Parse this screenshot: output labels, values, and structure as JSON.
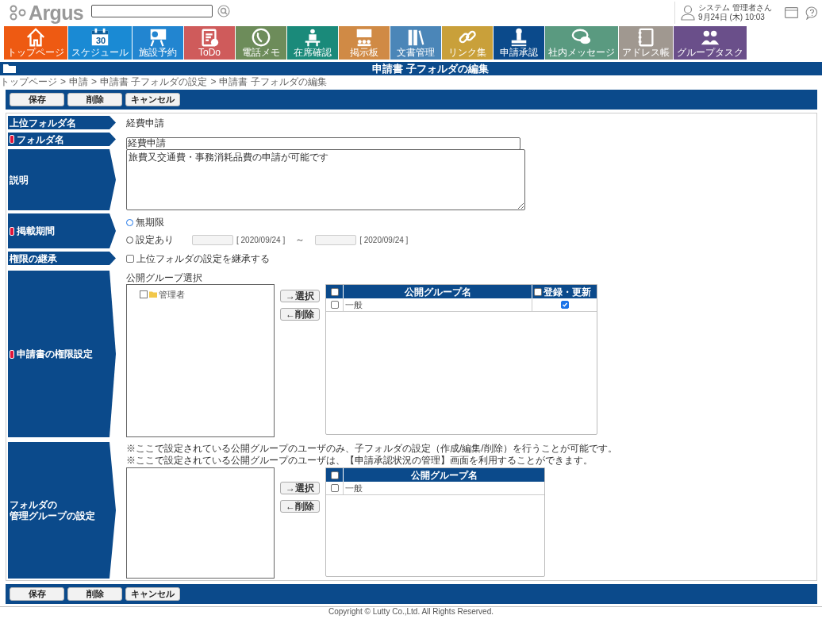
{
  "header": {
    "logo": "Argus",
    "user": {
      "name": "システム 管理者さん",
      "datetime": "9月24日 (木) 10:03"
    }
  },
  "nav": [
    {
      "label": "トップページ",
      "color": "#ee5a12"
    },
    {
      "label": "スケジュール",
      "icon_text": "30",
      "color": "#1a8ad4"
    },
    {
      "label": "施設予約",
      "color": "#2285d0"
    },
    {
      "label": "ToDo",
      "color": "#cf5b5b"
    },
    {
      "label": "電話メモ",
      "color": "#6d8c5a"
    },
    {
      "label": "在席確認",
      "color": "#1a8a7a"
    },
    {
      "label": "掲示板",
      "color": "#d08a45"
    },
    {
      "label": "文書管理",
      "color": "#4b86b8"
    },
    {
      "label": "リンク集",
      "color": "#c9a03a"
    },
    {
      "label": "申請承認",
      "color": "#0b4a8b"
    },
    {
      "label": "社内メッセージ",
      "color": "#5a9a80"
    },
    {
      "label": "アドレス帳",
      "color": "#a09890"
    },
    {
      "label": "グループタスク",
      "color": "#6a4f8a"
    }
  ],
  "title": "申請書 子フォルダの編集",
  "breadcrumb": {
    "separator": ">",
    "items": [
      "トップページ",
      "申請",
      "申請書 子フォルダの設定",
      "申請書 子フォルダの編集"
    ]
  },
  "top_buttons": [
    "保存",
    "削除",
    "キャンセル"
  ],
  "form": [
    {
      "kind": "text",
      "label": "上位フォルダ名",
      "required": false,
      "value": "経費申請"
    },
    {
      "kind": "input",
      "label": "フォルダ名",
      "required": true,
      "value": "経費申請"
    },
    {
      "kind": "textarea",
      "label": "説明",
      "required": false,
      "value": "旅費又交通費・事務消耗品費の申請が可能です"
    },
    {
      "kind": "period",
      "label": "掲載期間",
      "required": true,
      "options": [
        {
          "label": "無期限",
          "selected": true
        },
        {
          "label": "設定あり",
          "selected": false
        }
      ],
      "start_note": "[ 2020/09/24 ]",
      "separator": "～",
      "end_note": "[ 2020/09/24 ]"
    },
    {
      "kind": "checkbox",
      "label": "権限の継承",
      "required": false,
      "option": "上位フォルダの設定を継承する",
      "checked": false
    },
    {
      "kind": "groups",
      "label": "申請書の権限設定",
      "required": true,
      "caption": "公開グループ選択",
      "tree": [
        {
          "label": "管理者",
          "checked": false
        }
      ],
      "move_buttons": [
        "→選択",
        "←削除"
      ],
      "columns": [
        "公開グループ名",
        "登録・更新"
      ],
      "all_checked": false,
      "update_all_checked": false,
      "rows": [
        {
          "name": "一般",
          "checked": false,
          "update_checked": true
        }
      ]
    },
    {
      "kind": "groups",
      "label": [
        "フォルダの",
        "管理グループの設定"
      ],
      "required": false,
      "notes": [
        "※ここで設定されている公開グループのユーザのみ、子フォルダの設定（作成/編集/削除）を行うことが可能です。",
        "※ここで設定されている公開グループのユーザは、【申請承認状況の管理】画面を利用することができます。"
      ],
      "move_buttons": [
        "→選択",
        "←削除"
      ],
      "columns": [
        "公開グループ名"
      ],
      "all_checked": false,
      "rows": [
        {
          "name": "一般",
          "checked": false
        }
      ]
    }
  ],
  "bottom_buttons": [
    "保存",
    "削除",
    "キャンセル"
  ],
  "footer": "Copyright © Lutty Co.,Ltd. All Rights Reserved."
}
